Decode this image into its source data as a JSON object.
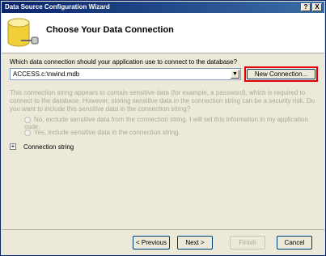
{
  "window": {
    "title": "Data Source Configuration Wizard",
    "help_btn": "?",
    "close_btn": "X"
  },
  "header": {
    "title": "Choose Your Data Connection"
  },
  "main": {
    "question": "Which data connection should your application use to connect to the database?",
    "connection_value": "ACCESS.c:\\nwind.mdb",
    "new_connection_label": "New Connection...",
    "info_text": "This connection string appears to contain sensitive data (for example, a password), which is required to connect to the database. However, storing sensitive data in the connection string can be a security risk. Do you want to include this sensitive data in the connection string?",
    "option_exclude": "No, exclude sensitive data from the connection string. I will set this information in my application code.",
    "option_include": "Yes, include sensitive data in the connection string.",
    "expand_symbol": "+",
    "connection_string_label": "Connection string"
  },
  "footer": {
    "previous_label": "< Previous",
    "next_label": "Next >",
    "finish_label": "Finish",
    "cancel_label": "Cancel"
  },
  "colors": {
    "title_bar": "#0a246a",
    "highlight": "#e00000",
    "disabled_text": "#aca899"
  },
  "icons": {
    "header": "database-icon"
  }
}
